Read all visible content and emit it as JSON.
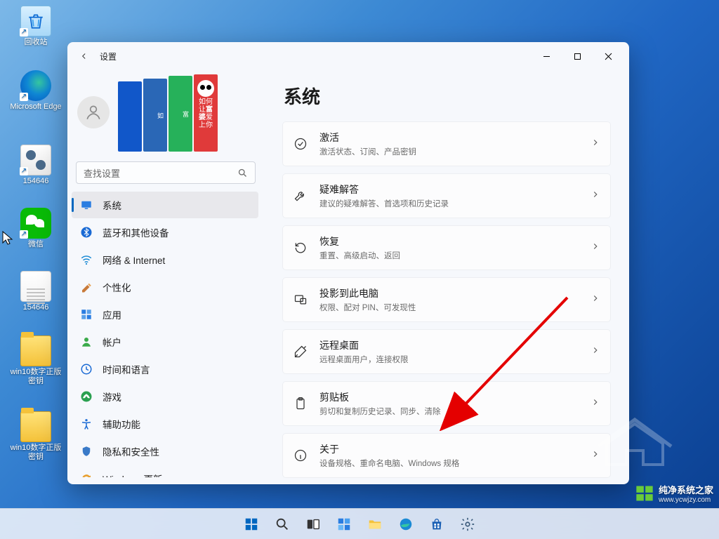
{
  "desktop_icons": {
    "recycle": "回收站",
    "edge": "Microsoft Edge",
    "cfg": "154646",
    "wechat": "微信",
    "txt": "154646",
    "folder1": "win10数字正版密钥",
    "folder2": "win10数字正版密钥"
  },
  "window": {
    "title": "设置",
    "search_placeholder": "查找设置"
  },
  "books": {
    "b4_line1": "如何让",
    "b4_line2": "富婆",
    "b4_line3": "爱上你"
  },
  "nav": [
    {
      "label": "系统",
      "icon": "system"
    },
    {
      "label": "蓝牙和其他设备",
      "icon": "bluetooth"
    },
    {
      "label": "网络 & Internet",
      "icon": "wifi"
    },
    {
      "label": "个性化",
      "icon": "personalize"
    },
    {
      "label": "应用",
      "icon": "apps"
    },
    {
      "label": "帐户",
      "icon": "account"
    },
    {
      "label": "时间和语言",
      "icon": "time"
    },
    {
      "label": "游戏",
      "icon": "gaming"
    },
    {
      "label": "辅助功能",
      "icon": "accessibility"
    },
    {
      "label": "隐私和安全性",
      "icon": "privacy"
    },
    {
      "label": "Windows 更新",
      "icon": "update"
    }
  ],
  "page": {
    "title": "系统"
  },
  "cards": [
    {
      "icon": "check",
      "title": "激活",
      "desc": "激活状态、订阅、产品密钥"
    },
    {
      "icon": "wrench",
      "title": "疑难解答",
      "desc": "建议的疑难解答、首选项和历史记录"
    },
    {
      "icon": "recover",
      "title": "恢复",
      "desc": "重置、高级启动、返回"
    },
    {
      "icon": "project",
      "title": "投影到此电脑",
      "desc": "权限、配对 PIN、可发现性"
    },
    {
      "icon": "remote",
      "title": "远程桌面",
      "desc": "远程桌面用户，连接权限"
    },
    {
      "icon": "clip",
      "title": "剪贴板",
      "desc": "剪切和复制历史记录、同步、清除"
    },
    {
      "icon": "about",
      "title": "关于",
      "desc": "设备规格、重命名电脑、Windows 规格"
    }
  ],
  "watermark": {
    "line1": "纯净系统之家",
    "line2": "www.ycwjzy.com"
  }
}
